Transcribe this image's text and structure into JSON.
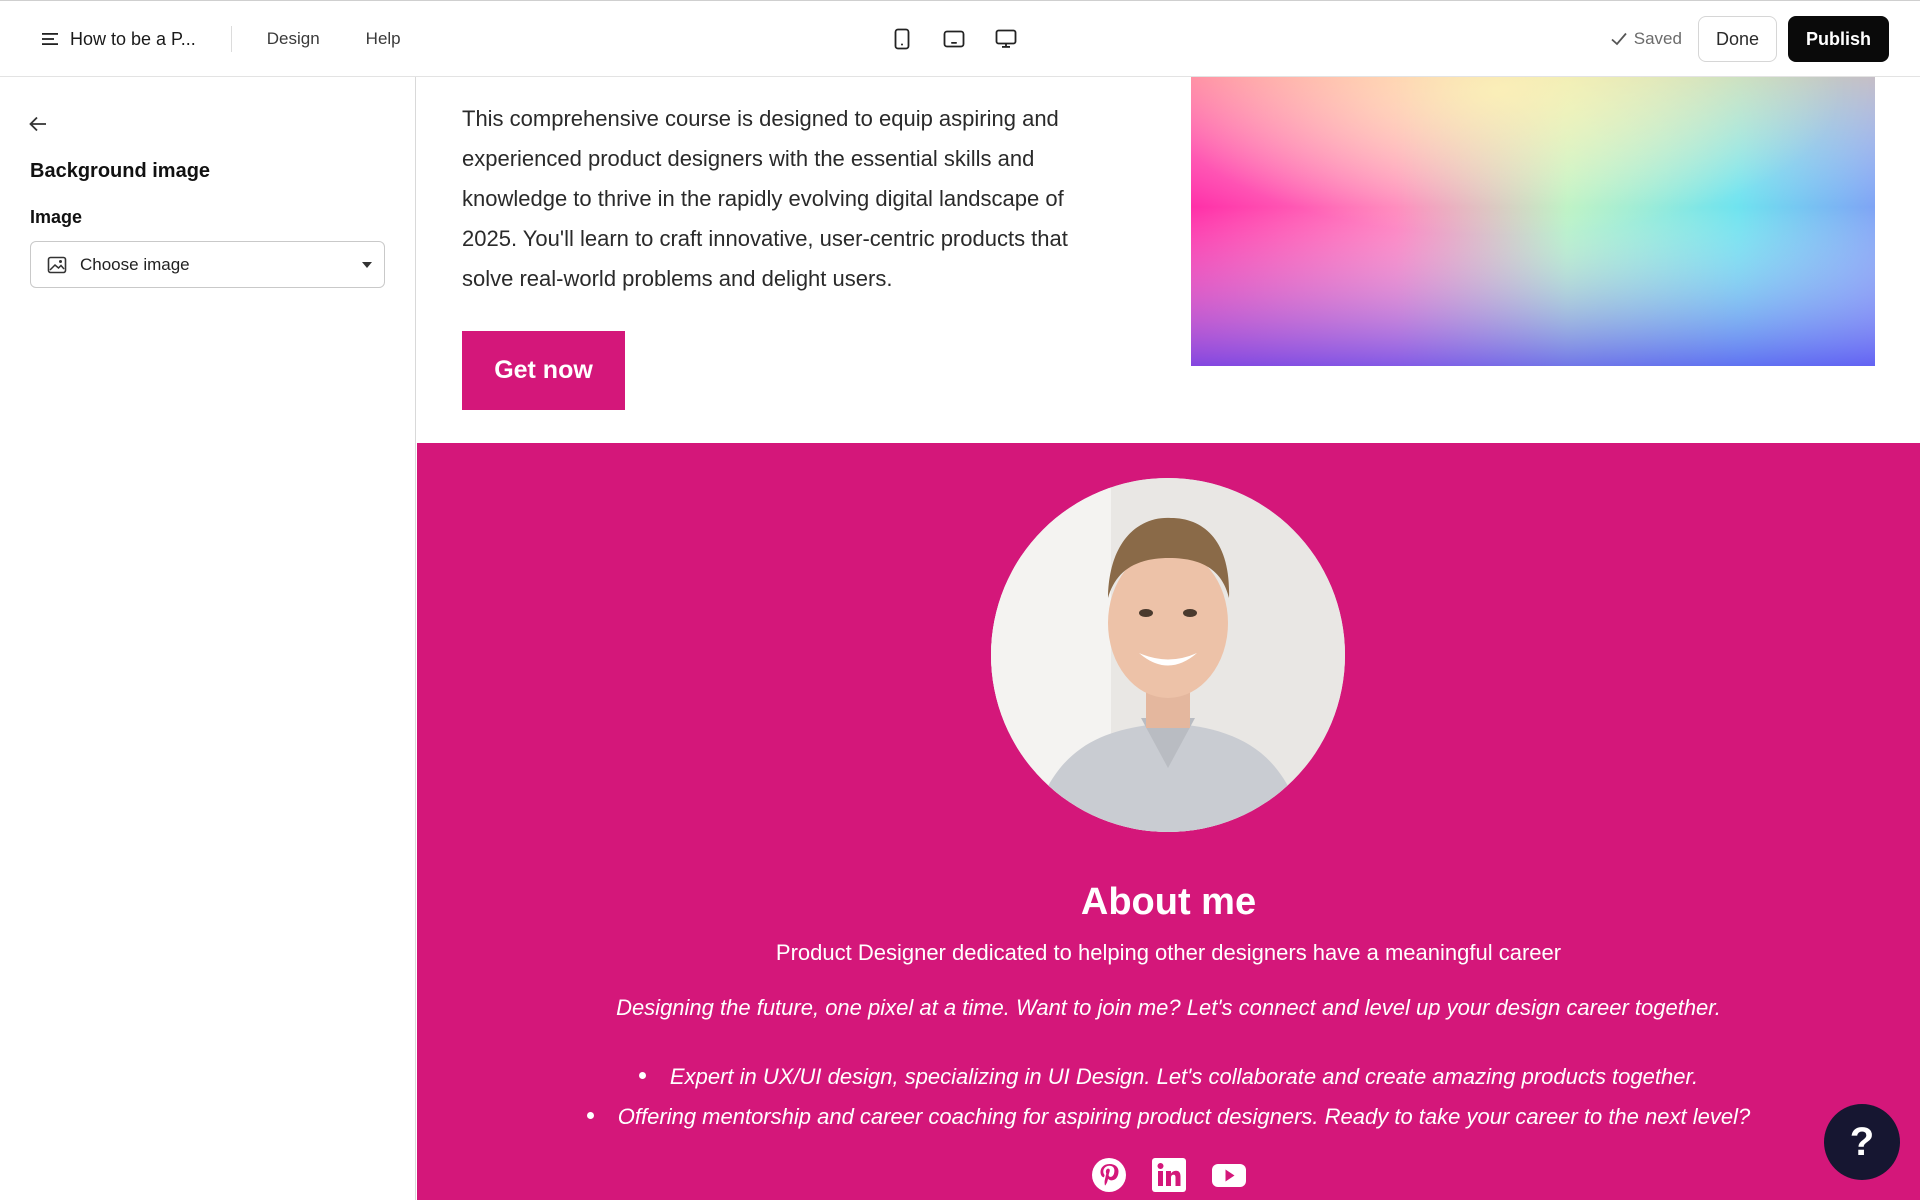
{
  "topbar": {
    "site_title": "How to be a P...",
    "nav": [
      "Design",
      "Help"
    ],
    "devices": [
      "mobile-device-icon",
      "tablet-device-icon",
      "desktop-device-icon"
    ],
    "saved_label": "Saved",
    "done_label": "Done",
    "publish_label": "Publish"
  },
  "sidebar": {
    "title": "Background image",
    "field_label": "Image",
    "select_value": "Choose image"
  },
  "canvas": {
    "intro": "This comprehensive course is designed to equip aspiring and experienced product designers with the essential skills and knowledge to thrive in the rapidly evolving digital landscape of 2025. You'll learn to craft innovative, user-centric products that solve real-world problems and delight users.",
    "cta_label": "Get now",
    "about": {
      "title": "About me",
      "subtitle": "Product Designer dedicated to helping other designers have a meaningful career",
      "quote": "Designing the future, one pixel at a time. Want to join me? Let's connect and level up your design career together.",
      "bullets": [
        "Expert in UX/UI design, specializing in UI Design. Let's collaborate and create amazing products together.",
        "Offering mentorship and career coaching for aspiring product designers. Ready to take your career to the next level?"
      ],
      "socials": [
        "pinterest-icon",
        "linkedin-icon",
        "youtube-icon"
      ]
    }
  },
  "help_fab": "?",
  "colors": {
    "accent": "#d4177a",
    "publish_bg": "#0a0a0a",
    "help_bg": "#161631"
  }
}
